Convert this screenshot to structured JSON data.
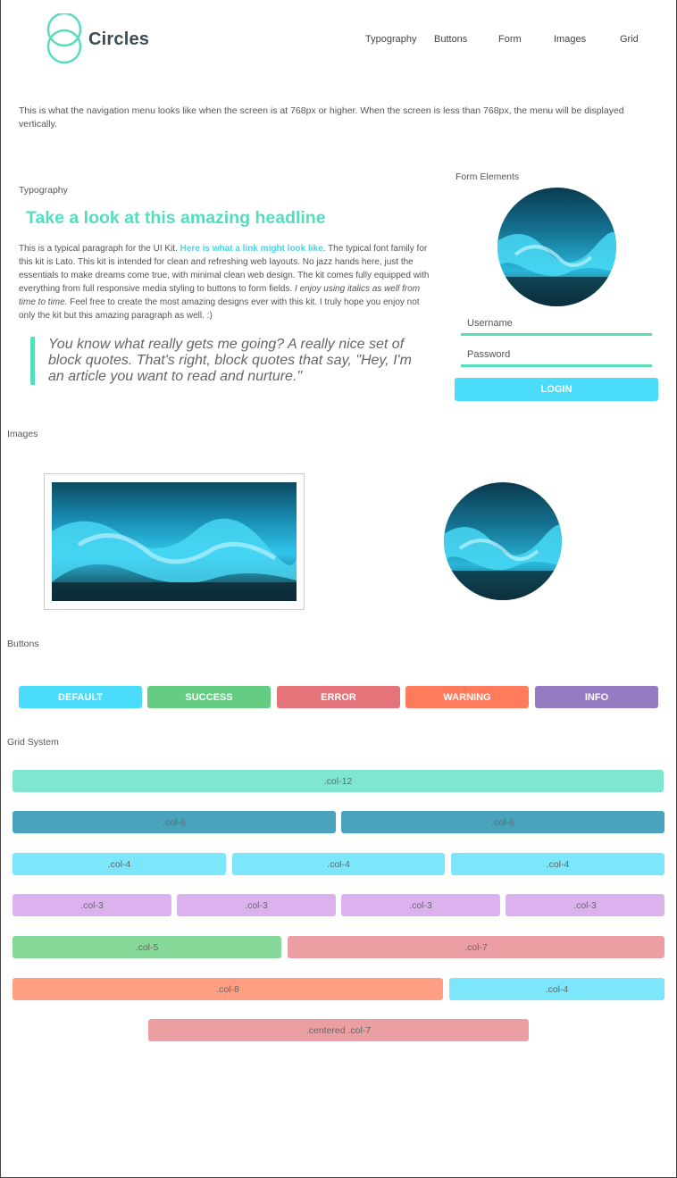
{
  "brand": {
    "name": "Circles",
    "color": "#57dcbe"
  },
  "nav": [
    "Typography",
    "Buttons",
    "Form",
    "Images",
    "Grid"
  ],
  "intro": "This is what the navigation menu looks like when the screen is at 768px or higher. When the screen is less than 768px, the menu will be displayed vertically.",
  "typography": {
    "label": "Typography",
    "headline": "Take a look at this amazing headline",
    "p1": "This is a typical paragraph for the UI Kit. ",
    "link": "Here is what a link might look like",
    "p2": ". The typical font family for this kit is Lato. This kit is intended for clean and refreshing web layouts. No jazz hands here, just the essentials to make dreams come true, with minimal clean web design. The kit comes fully equipped with everything from full responsive media styling to buttons to form fields. ",
    "italic": "I enjoy using italics as well from time to time.",
    "p3": " Feel free to create the most amazing designs ever with this kit. I truly hope you enjoy not only the kit but this amazing paragraph as well. :)",
    "quote": "You know what really gets me going? A really nice set of block quotes. That's right, block quotes that say, \"Hey, I'm an article you want to read and nurture.\""
  },
  "form": {
    "label": "Form Elements",
    "username_placeholder": "Username",
    "password_placeholder": "Password",
    "login": "LOGIN"
  },
  "images": {
    "label": "Images"
  },
  "buttons": {
    "label": "Buttons",
    "items": [
      {
        "label": "DEFAULT",
        "color": "#4cdcfb"
      },
      {
        "label": "SUCCESS",
        "color": "#64cd82"
      },
      {
        "label": "ERROR",
        "color": "#e47479"
      },
      {
        "label": "WARNING",
        "color": "#ff7b5b"
      },
      {
        "label": "INFO",
        "color": "#967ac2"
      }
    ]
  },
  "grid": {
    "label": "Grid System",
    "cells": [
      ".col-12",
      ".col-6",
      ".col-6",
      ".col-4",
      ".col-4",
      ".col-4",
      ".col-3",
      ".col-3",
      ".col-3",
      ".col-3",
      ".col-5",
      ".col-7",
      ".col-8",
      ".col-4",
      ".centered .col-7"
    ],
    "colors": {
      "col12": "#7fe6d1",
      "col6": "#49a3bd",
      "col4": "#7ce7fb",
      "col3": "#dcb2ee",
      "col5": "#86d999",
      "col7": "#eb9fa3",
      "col8": "#fe9f83"
    }
  }
}
